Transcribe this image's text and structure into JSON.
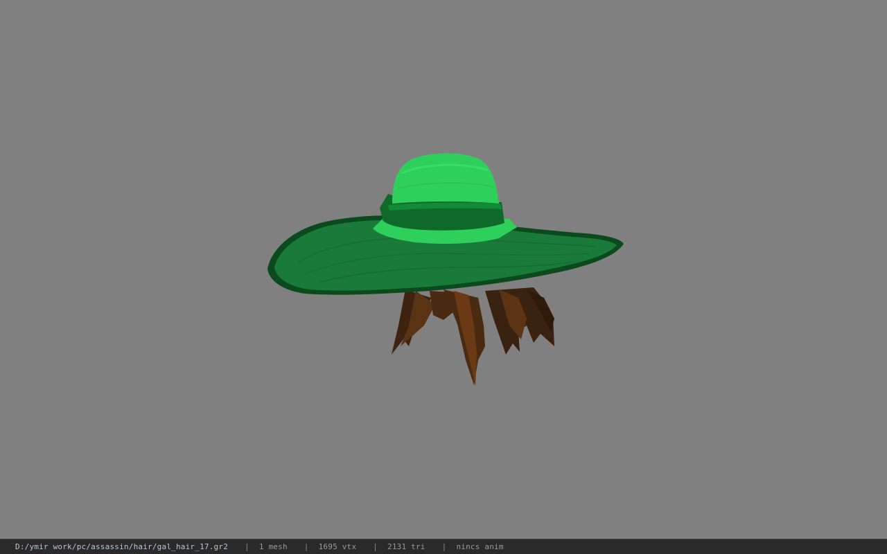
{
  "app": {
    "background_color": "#808080",
    "viewport_subject": "hat-and-hair-model"
  },
  "model": {
    "hat_brim_color": "#1a7a3a",
    "hat_crown_color": "#2fcf5c",
    "hat_band_color": "#0f6a2a",
    "hair_color": "#4a2a10"
  },
  "statusbar": {
    "file_path": "D:/ymir work/pc/assassin/hair/gal_hair_17.gr2",
    "separator": "|",
    "mesh_count": "1 mesh",
    "vertex_count": "1695 vtx",
    "triangle_count": "2131 tri",
    "animation": "nincs anim"
  }
}
